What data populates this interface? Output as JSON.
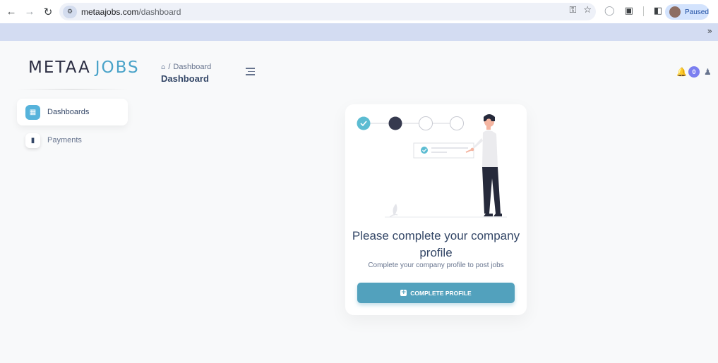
{
  "browser": {
    "url_domain": "metaajobs.com",
    "url_path": "/dashboard",
    "profile_label": "Paused",
    "icons": [
      "back-icon",
      "forward-icon",
      "reload-icon",
      "site-settings-icon",
      "password-key-icon",
      "bookmark-star-icon",
      "shield-extension-icon",
      "extensions-puzzle-icon",
      "side-panel-icon",
      "chevron-more-icon"
    ]
  },
  "brand": {
    "part1": "METAA",
    "part2": "JOBS"
  },
  "breadcrumb": {
    "current": "Dashboard"
  },
  "page_title": "Dashboard",
  "notifications": {
    "count": "0"
  },
  "sidebar": {
    "items": [
      {
        "label": "Dashboards",
        "icon": "store-icon",
        "active": true
      },
      {
        "label": "Payments",
        "icon": "wallet-icon",
        "active": false
      }
    ]
  },
  "card": {
    "title": "Please complete your company profile",
    "subtitle": "Complete your company profile to post jobs",
    "button_label": "COMPLETE PROFILE"
  },
  "colors": {
    "accent": "#52a1bd",
    "brand_blue": "#4aa3c9",
    "badge": "#7b7ff0"
  }
}
